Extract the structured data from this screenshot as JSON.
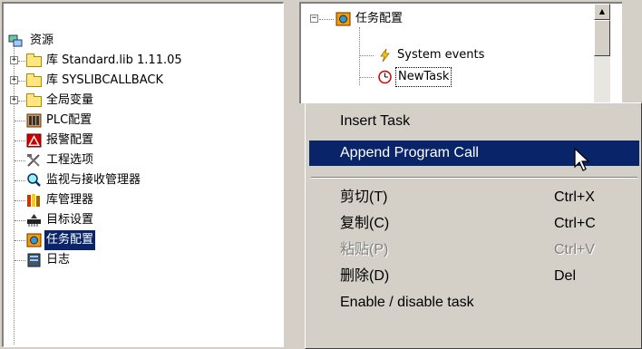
{
  "resource_tree": {
    "root_label": "资源",
    "items": [
      {
        "label": "库 Standard.lib 1.11.05"
      },
      {
        "label": "库 SYSLIBCALLBACK"
      },
      {
        "label": "全局变量"
      },
      {
        "label": "PLC配置"
      },
      {
        "label": "报警配置"
      },
      {
        "label": "工程选项"
      },
      {
        "label": "监视与接收管理器"
      },
      {
        "label": "库管理器"
      },
      {
        "label": "目标设置"
      },
      {
        "label": "任务配置"
      },
      {
        "label": "日志"
      }
    ],
    "expander_glyph": "+"
  },
  "task_tree": {
    "root_label": "任务配置",
    "expander_glyph": "−",
    "children": [
      {
        "label": "System events"
      },
      {
        "label": "NewTask"
      }
    ]
  },
  "scrollbar": {
    "up_glyph": "▲"
  },
  "context_menu": {
    "items": [
      {
        "label": "Insert Task",
        "shortcut": ""
      },
      {
        "label": "Append Program Call",
        "shortcut": ""
      },
      {
        "label": "剪切(T)",
        "shortcut": "Ctrl+X"
      },
      {
        "label": "复制(C)",
        "shortcut": "Ctrl+C"
      },
      {
        "label": "粘贴(P)",
        "shortcut": "Ctrl+V"
      },
      {
        "label": "删除(D)",
        "shortcut": "Del"
      },
      {
        "label": "Enable / disable task",
        "shortcut": ""
      }
    ]
  },
  "colors": {
    "selection": "#0a246a",
    "face": "#d4d0c8",
    "disabled_text": "#808080"
  }
}
